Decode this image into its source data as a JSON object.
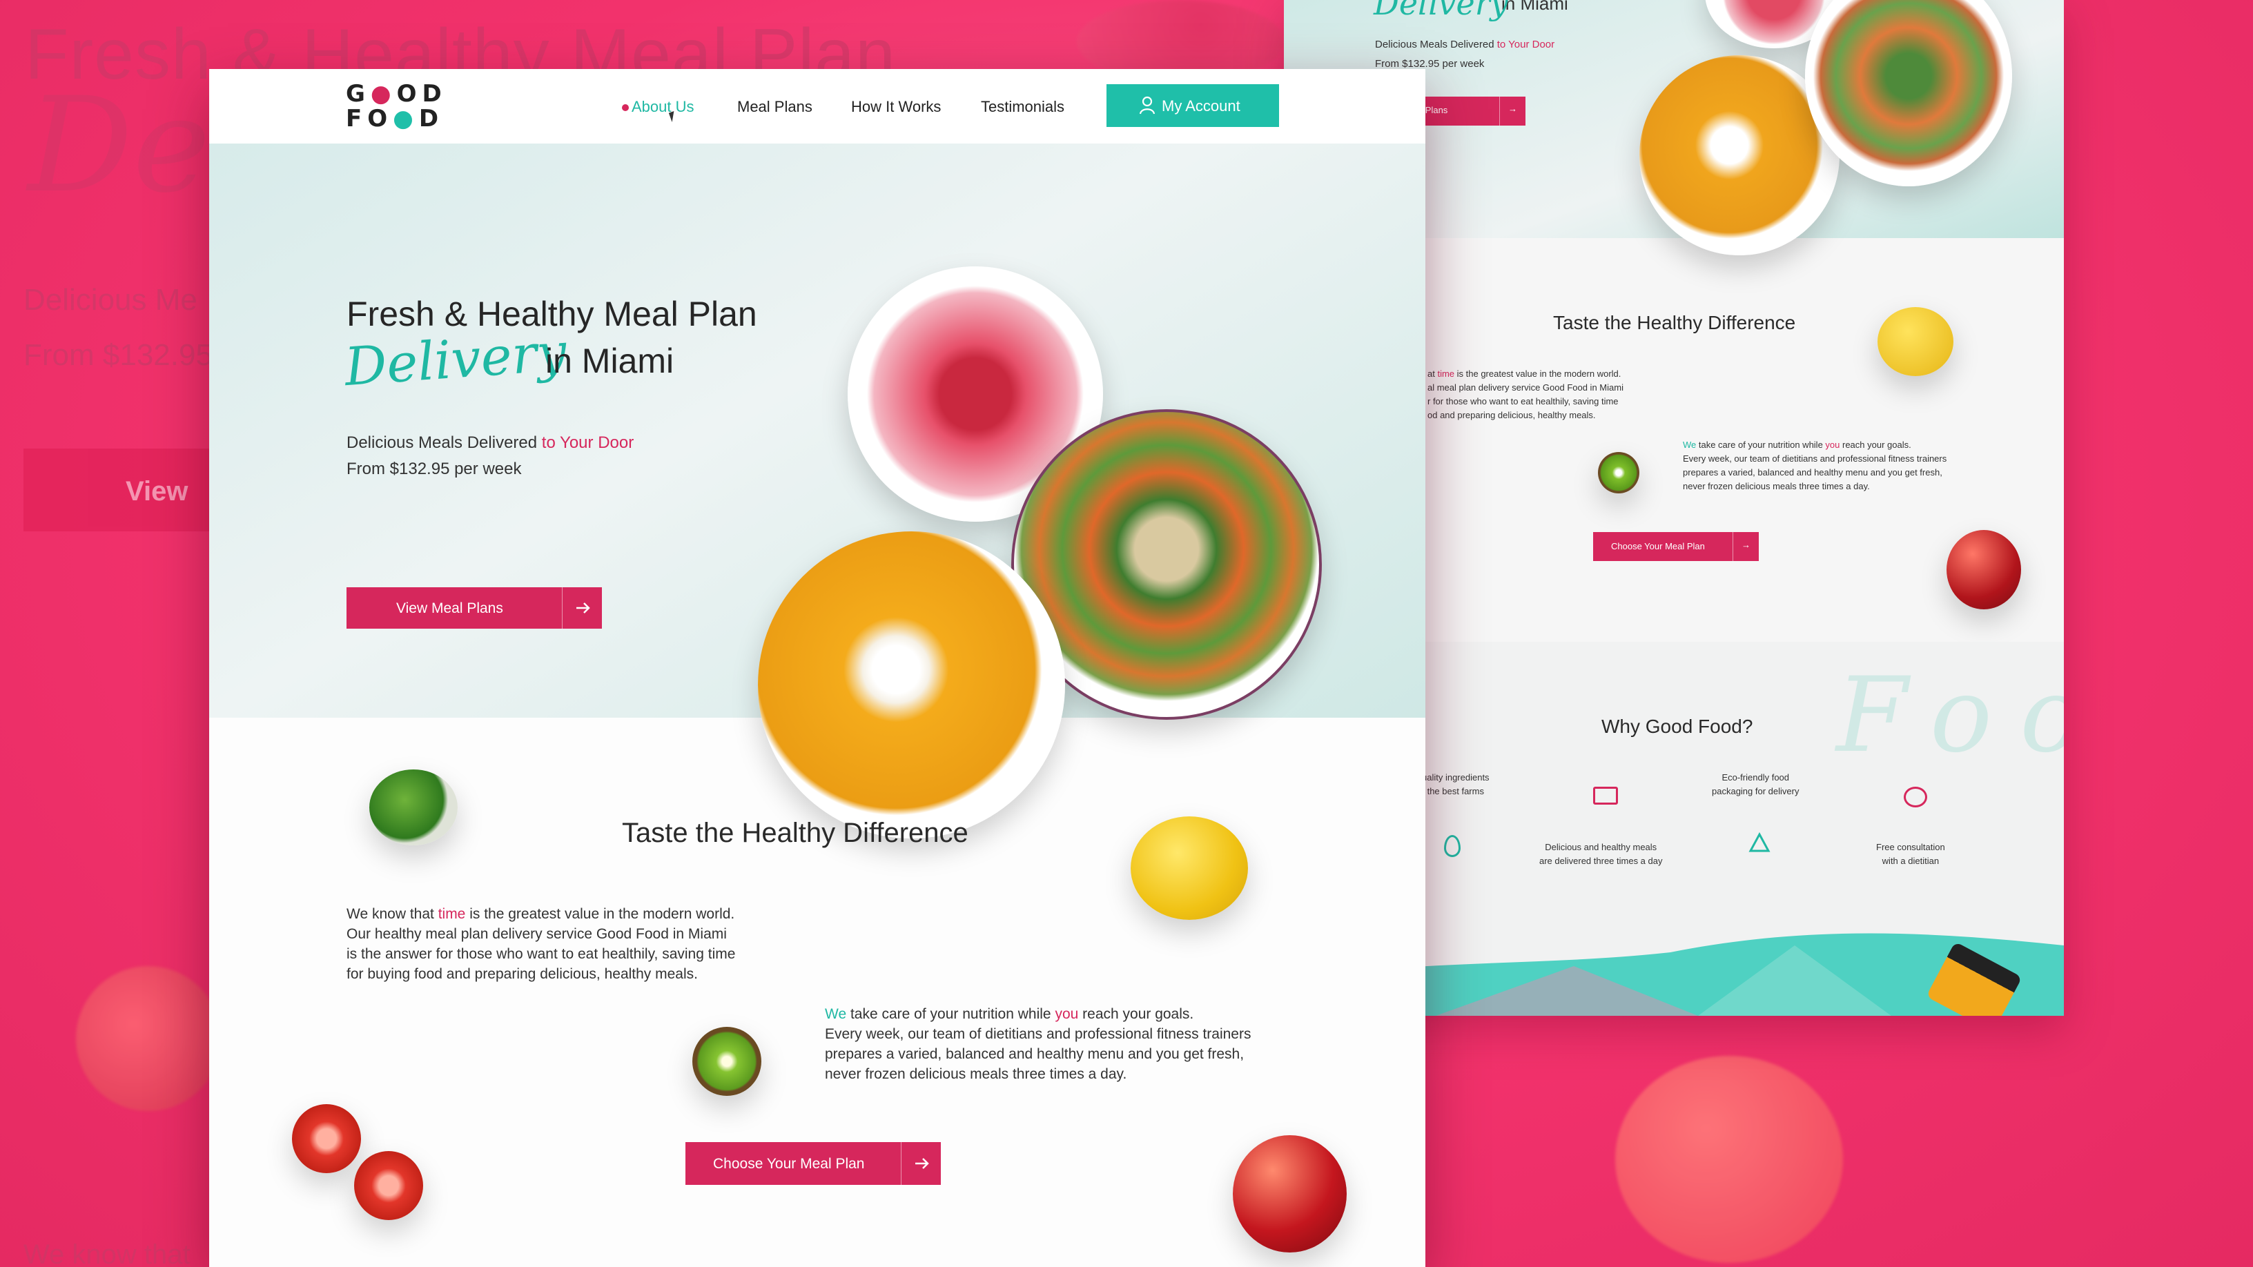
{
  "backdrop": {
    "big_title": "Fresh & Healthy Meal Plan",
    "line1": "Delicious Me",
    "line2": "From $132.95",
    "button_label": "View",
    "bottom_text": "We know that",
    "bg_color": "#f2356f"
  },
  "front": {
    "logo": {
      "line1": "GOOD",
      "line2": "FOOD"
    },
    "nav": {
      "items": [
        {
          "label": "About Us",
          "active": true
        },
        {
          "label": "Meal Plans"
        },
        {
          "label": "How It Works"
        },
        {
          "label": "Testimonials"
        }
      ],
      "account_label": "My Account"
    },
    "hero": {
      "title_line1": "Fresh & Healthy Meal Plan",
      "title_script": "Delivery",
      "title_line2": "in Miami",
      "subtitle_prefix": "Delicious Meals Delivered ",
      "subtitle_highlight": "to Your Door",
      "price_text": "From $132.95 per week",
      "cta_label": "View Meal Plans"
    },
    "taste": {
      "title": "Taste the Healthy Difference",
      "para1": {
        "line1_pre": "We know that ",
        "line1_hl": "time",
        "line1_post": " is the greatest value in the modern world.",
        "line2": "Our healthy meal plan delivery service Good Food in Miami",
        "line3": "is the answer for those who want to eat healthily, saving time",
        "line4": "for buying food and preparing delicious, healthy meals."
      },
      "para2": {
        "w1": "We",
        "mid": " take care of your nutrition while ",
        "w2": "you",
        "end": " reach your goals.",
        "line2": "Every week, our team of dietitians and professional fitness trainers",
        "line3": "prepares a varied, balanced and healthy menu and you get fresh,",
        "line4": "never frozen delicious meals three times a day."
      },
      "cta_label": "Choose Your Meal Plan"
    }
  },
  "back": {
    "hero_title_fragment": "in Miami",
    "hero_sub_prefix": "Delicious Meals Delivered ",
    "hero_sub_highlight": "to Your Door",
    "hero_price": "From $132.95 per week",
    "hero_btn": "Meal Plans",
    "taste_title": "Taste the Healthy Difference",
    "p1": {
      "l1_pre": "at ",
      "l1_hl": "time",
      "l1_post": " is the greatest value in the modern world.",
      "l2": "al meal plan delivery service Good Food in Miami",
      "l3": "r for those who want to eat healthily, saving time",
      "l4": "od and preparing delicious, healthy meals."
    },
    "p2": {
      "w1": "We",
      "mid": " take care of your nutrition while ",
      "w2": "you",
      "end": " reach your goals.",
      "l2": "Every week, our team of dietitians and professional fitness trainers",
      "l3": "prepares a varied, balanced and healthy menu and you get fresh,",
      "l4": "never frozen delicious meals three times a day."
    },
    "taste_btn": "Choose Your Meal Plan",
    "why_title": "Why Good Food?",
    "why_script": "Food",
    "features": {
      "f1_l1": "uality ingredients",
      "f1_l2": "the best farms",
      "f2_l1": "Delicious and healthy meals",
      "f2_l2": "are delivered three times a day",
      "f3_l1": "Eco-friendly food",
      "f3_l2": "packaging for delivery",
      "f4_l1": "Free consultation",
      "f4_l2": "with a dietitian"
    }
  },
  "colors": {
    "accent_pink": "#d6275c",
    "accent_teal": "#1fbfa9"
  }
}
